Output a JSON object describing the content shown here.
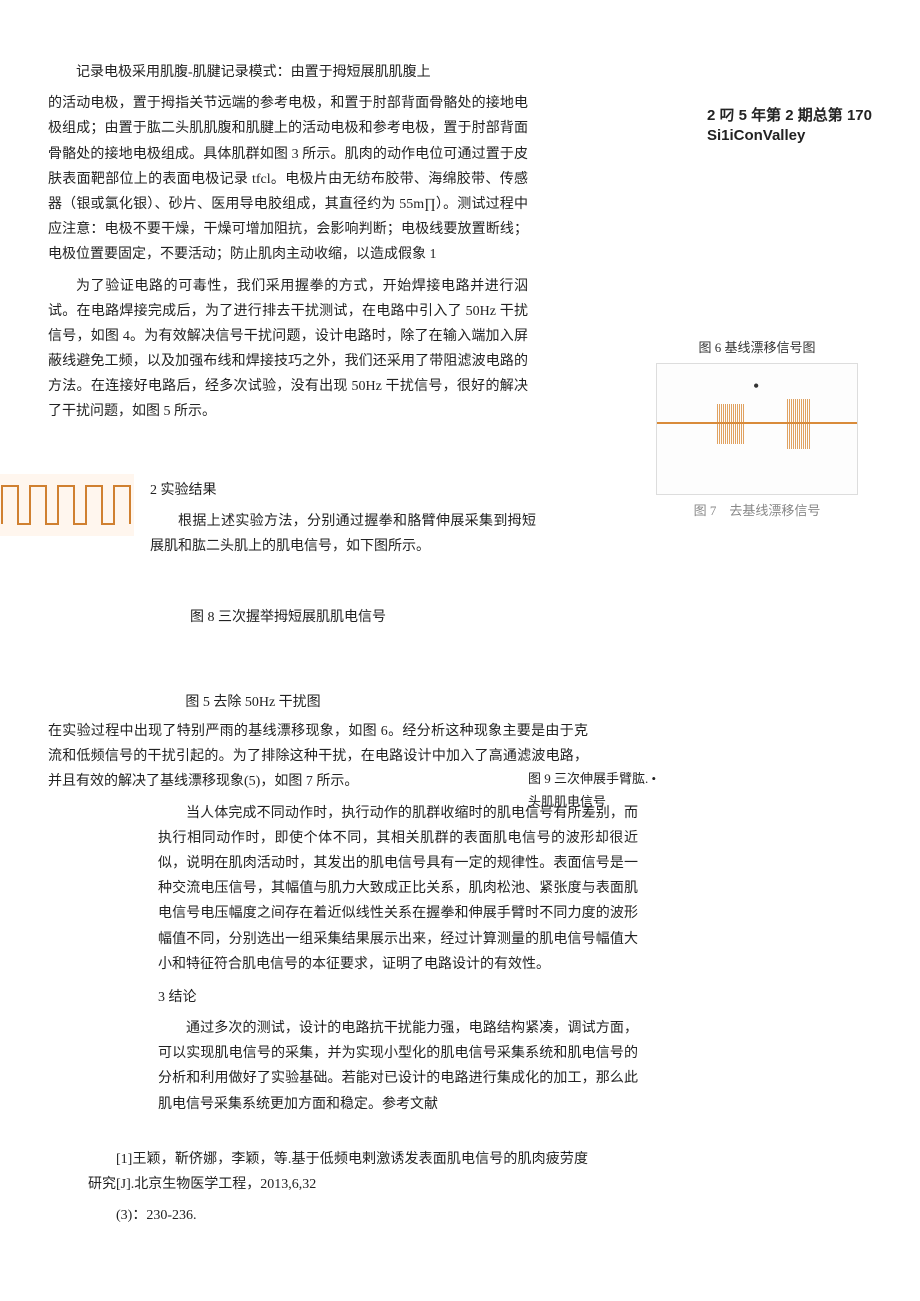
{
  "header": {
    "line1": "2 叼 5 年第 2 期总第 170",
    "line2": "Si1iConValley"
  },
  "para1_line1": "记录电极采用肌腹-肌腱记录模式：由置于拇短展肌肌腹上",
  "para1_body": "的活动电极，置于拇指关节远端的参考电极，和置于肘部背面骨骼处的接地电极组成；由置于肱二头肌肌腹和肌腱上的活动电极和参考电极，置于肘部背面骨骼处的接地电极组成。具体肌群如图 3 所示。肌肉的动作电位可通过置于皮肤表面靶部位上的表面电极记录 tfcl。电极片由无纺布胶带、海绵胶带、传感器（银或氯化银）、砂片、医用导电胶组成，其直径约为 55m∏）。测试过程中应注意：电极不要干燥，干燥可增加阻抗，会影响判断；电极线要放置断线；电极位置要固定，不要活动；防止肌肉主动收缩，以造成假象 1",
  "para2": "为了验证电路的可毒性，我们采用握拳的方式，开始焊接电路并进行泅试。在电路焊接完成后，为了进行排去干扰测试，在电路中引入了 50Hz 干扰信号，如图 4。为有效解决信号干扰问题，设计电路时，除了在输入端加入屏蔽线避免工频，以及加强布线和焊接技巧之外，我们还采用了带阻滤波电路的方法。在连接好电路后，经多次试验，没有出现 50Hz 干扰信号，很好的解决了干扰问题，如图 5 所示。",
  "section2_head": "2 实验结果",
  "section2_body": "根据上述实验方法，分别通过握拳和胳臂伸展采集到拇短展肌和肱二头肌上的肌电信号，如下图所示。",
  "fig6_caption": "图 6 基线漂移信号图",
  "fig7_caption": "图 7　去基线漂移信号",
  "fig8_caption": "图 8 三次握举拇短展肌肌电信号",
  "fig5_caption": "图 5 去除 50Hz 干扰图",
  "baseline_para": "在实验过程中出现了特别严雨的基线漂移现象，如图 6。经分析这种现象主要是由于克流和低频信号的干扰引起的。为了排除这种干扰，在电路设计中加入了高通滤波电路，并且有效的解决了基线漂移现象(5)，如图 7 所示。",
  "fig9_caption": "图 9 三次伸展手臂肱. •头肌肌电信号",
  "discussion": "当人体完成不同动作时，执行动作的肌群收缩时的肌电信号有所差别，而执行相同动作时，即使个体不同，其相关肌群的表面肌电信号的波形却很近似，说明在肌肉活动时，其发出的肌电信号具有一定的规律性。表面信号是一种交流电压信号，其幅值与肌力大致成正比关系，肌肉松池、紧张度与表面肌电信号电压幅度之间存在着近似线性关系在握拳和伸展手臂时不同力度的波形幅值不同，分别选出一组采集结果展示出来，经过计算测量的肌电信号幅值大小和特征符合肌电信号的本征要求，证明了电路设计的有效性。",
  "section3_head": "3 结论",
  "conclusion": "通过多次的测试，设计的电路抗干扰能力强，电路结构紧凑，调试方面，可以实现肌电信号的采集，并为实现小型化的肌电信号采集系统和肌电信号的分析和利用做好了实验基础。若能对已设计的电路进行集成化的加工，那么此肌电信号采集系统更加方面和稳定。参考文献",
  "ref1": "[1]王颖，靳侪娜，李颖，等.基于低频电剌激诱发表面肌电信号的肌肉疲劳度研究[J].北京生物医学工程，2013,6,32",
  "ref1b": "(3)：230-236."
}
